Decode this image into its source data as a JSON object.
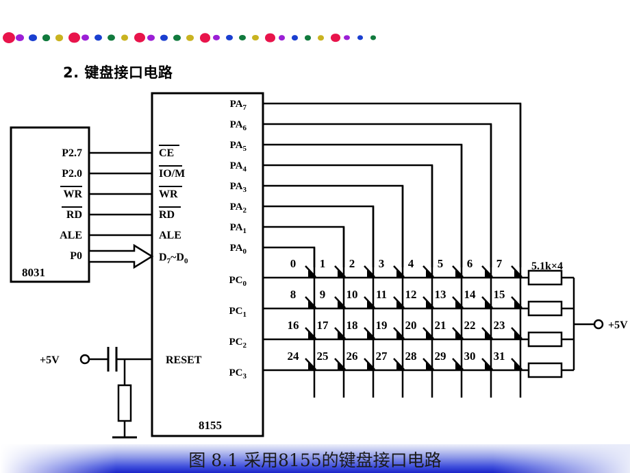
{
  "slide": {
    "heading": "2. 键盘接口电路",
    "caption": "图 8.1 采用8155的键盘接口电路",
    "footer_gradient_top": "#eef0fb",
    "footer_gradient_bottom": "#1b26c9"
  },
  "ribbon": {
    "colors": [
      "#e8144b",
      "#9b1fd6",
      "#1a3fd0",
      "#117a3d",
      "#c9b320"
    ],
    "big_radius": 9,
    "small_radius": 6,
    "count": 29
  },
  "mcu": {
    "label": "8031",
    "pins": [
      "P2.7",
      "P2.0",
      "WR",
      "RD",
      "ALE",
      "P0"
    ],
    "overline": [
      false,
      false,
      true,
      true,
      false,
      false
    ]
  },
  "ppi": {
    "label": "8155",
    "left_pins": [
      {
        "text": "CE",
        "overline": "full"
      },
      {
        "text": "IO/M",
        "overline": "partial"
      },
      {
        "text": "WR",
        "overline": "full"
      },
      {
        "text": "RD",
        "overline": "full"
      },
      {
        "text": "ALE",
        "overline": "none"
      },
      {
        "text": "D7~D0",
        "overline": "none"
      }
    ],
    "reset_pin": "RESET",
    "port_a": [
      "PA7",
      "PA6",
      "PA5",
      "PA4",
      "PA3",
      "PA2",
      "PA1",
      "PA0"
    ],
    "port_c": [
      "PC0",
      "PC1",
      "PC2",
      "PC3"
    ]
  },
  "reset_circuit": {
    "supply_label": "+5V"
  },
  "keypad": {
    "columns": 8,
    "rows": 4,
    "keys": [
      [
        "0",
        "1",
        "2",
        "3",
        "4",
        "5",
        "6",
        "7"
      ],
      [
        "8",
        "9",
        "10",
        "11",
        "12",
        "13",
        "14",
        "15"
      ],
      [
        "16",
        "17",
        "18",
        "19",
        "20",
        "21",
        "22",
        "23"
      ],
      [
        "24",
        "25",
        "26",
        "27",
        "28",
        "29",
        "30",
        "31"
      ]
    ]
  },
  "pullups": {
    "label": "5.1k×4",
    "count": 4,
    "supply_label": "+5V"
  }
}
